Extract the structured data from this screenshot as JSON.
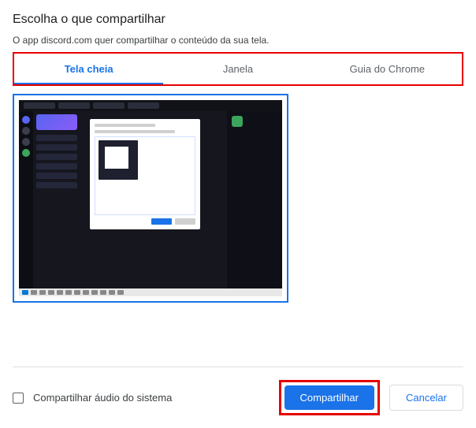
{
  "dialog": {
    "title": "Escolha o que compartilhar",
    "subtitle": "O app discord.com quer compartilhar o conteúdo da sua tela."
  },
  "tabs": {
    "fullscreen": "Tela cheia",
    "window": "Janela",
    "chrome_tab": "Guia do Chrome"
  },
  "footer": {
    "share_audio_label": "Compartilhar áudio do sistema",
    "share_button": "Compartilhar",
    "cancel_button": "Cancelar"
  }
}
